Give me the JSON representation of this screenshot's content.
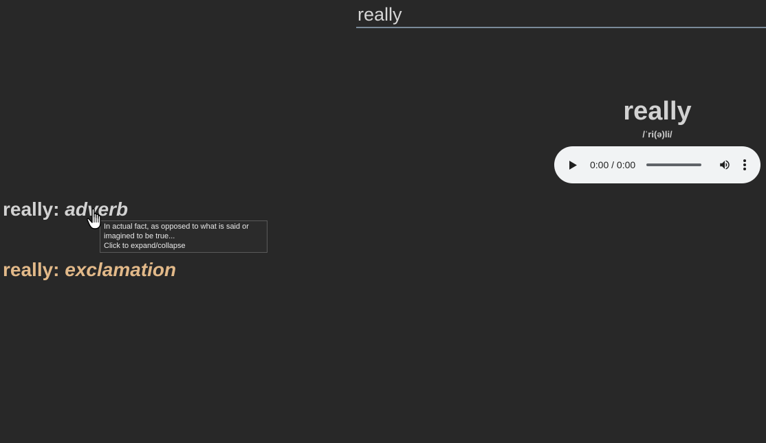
{
  "search": {
    "value": "really"
  },
  "entry": {
    "headword": "really",
    "pronunciation": "/ˈri(ə)li/"
  },
  "audio": {
    "time": "0:00 / 0:00",
    "play_icon": "play-icon",
    "volume_icon": "volume-icon",
    "more_icon": "more-vert-icon",
    "progress": 0
  },
  "senses": [
    {
      "word": "really: ",
      "pos": "adverb",
      "color": "#d2d2d2"
    },
    {
      "word": "really: ",
      "pos": "exclamation",
      "color": "#e2b989"
    }
  ],
  "tooltip": {
    "line1": "In actual fact, as opposed to what is said or",
    "line2": "imagined to be true...",
    "line3": "Click to expand/collapse"
  },
  "colors": {
    "background": "#282828",
    "search_underline": "#7a8a99",
    "exclamation_accent": "#e2b989"
  }
}
